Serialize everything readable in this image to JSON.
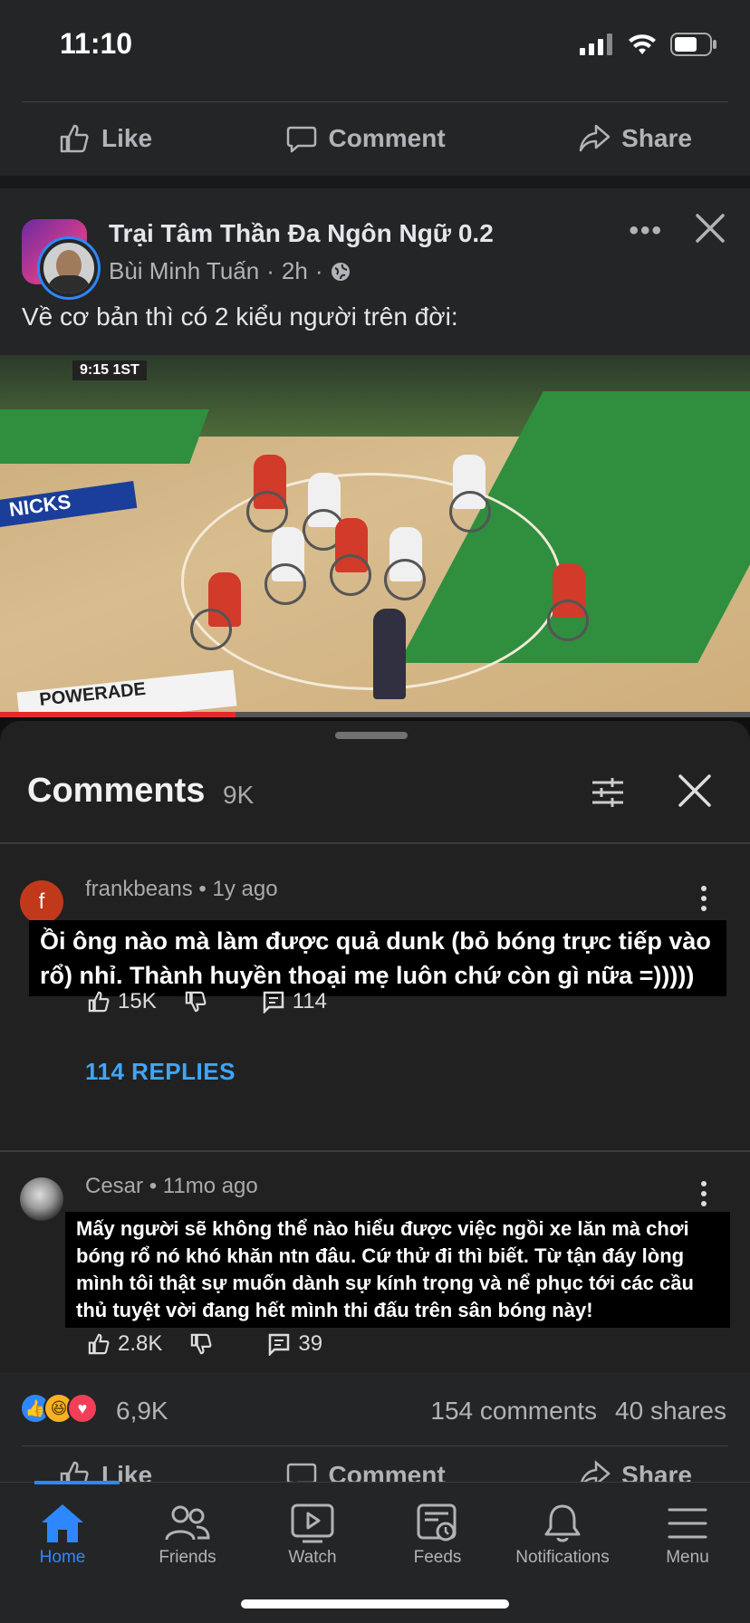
{
  "status_bar": {
    "time": "11:10"
  },
  "post_actions": {
    "like": "Like",
    "comment": "Comment",
    "share": "Share"
  },
  "post": {
    "group_name": "Trại Tâm Thần Đa Ngôn Ngữ 0.2",
    "author": "Bùi Minh Tuấn",
    "time": "2h",
    "separator": "·",
    "text": "Về cơ bản thì có 2 kiểu người trên đời:"
  },
  "video": {
    "scoreboard": "9:15  1ST",
    "left_sign": "NICKS",
    "bottom_sign": "POWERADE"
  },
  "comments_sheet": {
    "title": "Comments",
    "count": "9K",
    "comments": [
      {
        "author": "frankbeans",
        "time": "1y ago",
        "avatar_letter": "f",
        "text": "Ồi ông nào mà làm được quả dunk (bỏ bóng trực tiếp vào rổ) nhỉ. Thành huyền thoại mẹ luôn chứ còn gì nữa =)))))",
        "likes": "15K",
        "replies_count": "114",
        "replies_link": "114 REPLIES"
      },
      {
        "author": "Cesar",
        "time": "11mo ago",
        "text": "Mấy người sẽ không thể nào hiểu được việc ngồi xe lăn mà chơi bóng rổ nó khó khăn ntn đâu. Cứ thử đi thì biết. Từ tận đáy lòng mình tôi thật sự muốn dành sự kính trọng và nể phục tới các cầu thủ tuyệt vời đang hết mình thi đấu trên sân bóng này!",
        "likes": "2.8K",
        "replies_count": "39"
      }
    ]
  },
  "reactions": {
    "count": "6,9K",
    "comments": "154 comments",
    "shares": "40 shares"
  },
  "tabs": [
    {
      "label": "Home",
      "icon": "home-icon"
    },
    {
      "label": "Friends",
      "icon": "friends-icon"
    },
    {
      "label": "Watch",
      "icon": "watch-icon"
    },
    {
      "label": "Feeds",
      "icon": "feeds-icon"
    },
    {
      "label": "Notifications",
      "icon": "bell-icon"
    },
    {
      "label": "Menu",
      "icon": "menu-icon"
    }
  ],
  "colors": {
    "background": "#242526",
    "accent": "#2d88ff",
    "link": "#3ea6ff",
    "like_reaction": "#2d88ff",
    "haha_reaction": "#f7b125",
    "love_reaction": "#f33e58"
  }
}
